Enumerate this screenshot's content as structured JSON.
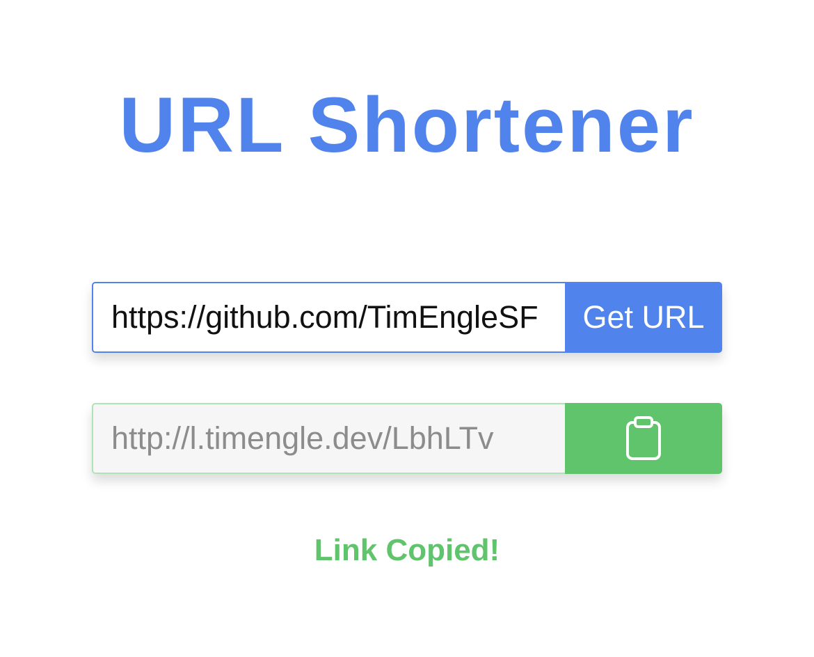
{
  "header": {
    "title": "URL Shortener"
  },
  "form": {
    "url_value": "https://github.com/TimEngleSF",
    "get_button_label": "Get URL"
  },
  "result": {
    "short_url": "http://l.timengle.dev/LbhLTv",
    "copy_icon": "clipboard-icon"
  },
  "status": {
    "message": "Link Copied!"
  },
  "colors": {
    "primary": "#5083eb",
    "success": "#5fc46c",
    "success_border": "#aee3b6",
    "output_background": "#f6f6f6",
    "output_text": "#8c8c8c"
  }
}
